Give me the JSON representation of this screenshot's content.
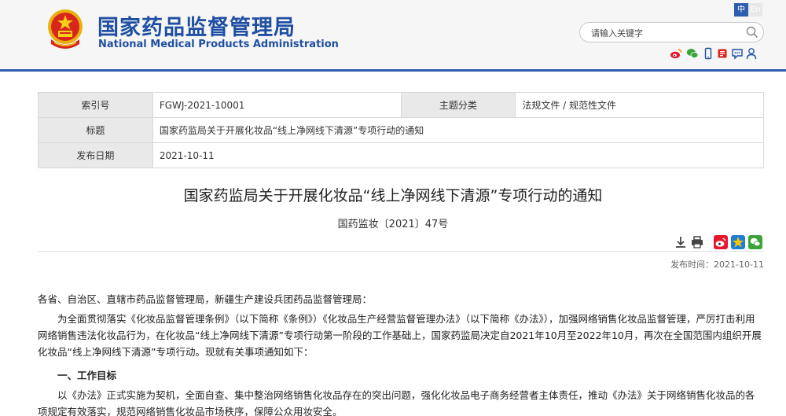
{
  "header": {
    "title_cn": "国家药品监督管理局",
    "title_en": "National Medical Products Administration",
    "lang_zh": "中",
    "lang_en": "En",
    "search_placeholder": "请输入关键字"
  },
  "social_icons": [
    "weibo-icon",
    "wechat-icon",
    "mobile-icon",
    "mail-icon",
    "comment-icon",
    "user-icon"
  ],
  "meta": {
    "index_label": "索引号",
    "index_value": "FGWJ-2021-10001",
    "category_label": "主题分类",
    "category_value": "法规文件 / 规范性文件",
    "title_label": "标题",
    "title_value": "国家药监局关于开展化妆品“线上净网线下清源”专项行动的通知",
    "date_label": "发布日期",
    "date_value": "2021-10-11"
  },
  "article": {
    "title": "国家药监局关于开展化妆品“线上净网线下清源”专项行动的通知",
    "doc_number": "国药监妆〔2021〕47号",
    "publish_time": "发布时间：2021-10-11",
    "salutation": "各省、自治区、直辖市药品监督管理局，新疆生产建设兵团药品监督管理局：",
    "paragraph_1": "为全面贯彻落实《化妆品监督管理条例》（以下简称《条例》）《化妆品生产经营监督管理办法》（以下简称《办法》），加强网络销售化妆品监督管理，严厉打击利用网络销售违法化妆品行为，在化妆品“线上净网线下清源”专项行动第一阶段的工作基础上，国家药监局决定自2021年10月至2022年10月，再次在全国范围内组织开展化妆品“线上净网线下清源”专项行动。现就有关事项通知如下：",
    "section_1": "一、工作目标",
    "paragraph_2": "以《办法》正式实施为契机，全面自查、集中整治网络销售化妆品存在的突出问题，强化化妆品电子商务经营者主体责任，推动《办法》关于网络销售化妆品的各项规定有效落实，规范网络销售化妆品市场秩序，保障公众用妆安全。"
  },
  "colors": {
    "brand_blue": "#1f4fa3",
    "header_line": "#2e5dae"
  }
}
